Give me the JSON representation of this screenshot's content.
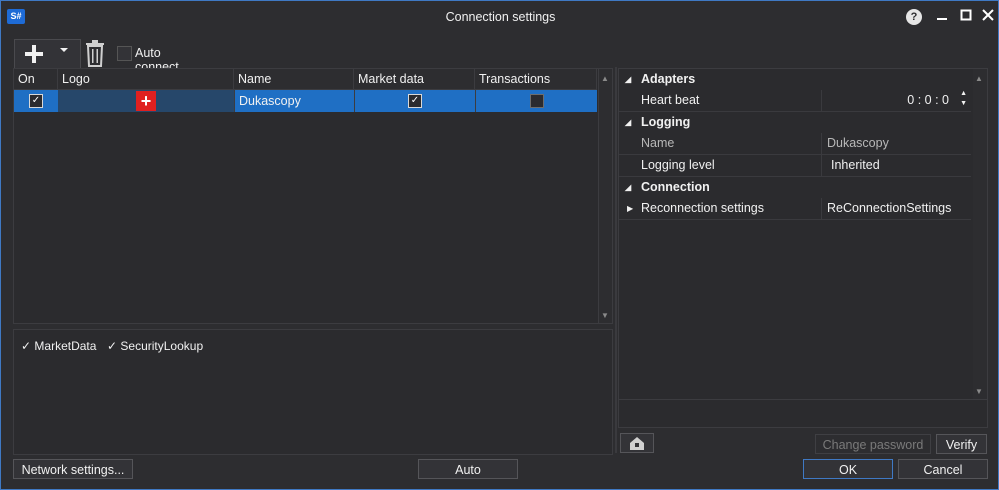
{
  "window": {
    "app_icon_text": "S#",
    "title": "Connection settings",
    "help_icon": "?",
    "minimize_icon": "–",
    "maximize_icon": "□",
    "close_icon": "✕"
  },
  "toolbar": {
    "add_icon": "plus-icon",
    "dropdown_icon": "caret-down-icon",
    "delete_icon": "trash-icon",
    "auto_connect_label": "Auto connect",
    "auto_connect_checked": false
  },
  "grid": {
    "columns": [
      "On",
      "Logo",
      "Name",
      "Market data",
      "Transactions"
    ],
    "rows": [
      {
        "on": true,
        "logo": "swiss-flag-icon",
        "name": "Dukascopy",
        "market_data": true,
        "transactions": false
      }
    ]
  },
  "messages": {
    "items": [
      {
        "label": "MarketData",
        "checked": true
      },
      {
        "label": "SecurityLookup",
        "checked": true
      }
    ]
  },
  "properties": {
    "categories": [
      {
        "name": "Adapters",
        "rows": [
          {
            "name": "Heart beat",
            "value": "0 : 0 : 0"
          }
        ]
      },
      {
        "name": "Logging",
        "rows": [
          {
            "name": "Name",
            "value": "Dukascopy",
            "disabled": true
          },
          {
            "name": "Logging level",
            "value": "Inherited"
          }
        ]
      },
      {
        "name": "Connection",
        "rows": [
          {
            "name": "Reconnection settings",
            "value": "ReConnectionSettings"
          }
        ]
      }
    ]
  },
  "buttons": {
    "network_settings": "Network settings...",
    "auto": "Auto",
    "change_password": "Change password",
    "verify": "Verify",
    "ok": "OK",
    "cancel": "Cancel"
  },
  "colors": {
    "accent": "#1f6fc4",
    "background": "#2d2d30",
    "border": "#3f79c4"
  }
}
